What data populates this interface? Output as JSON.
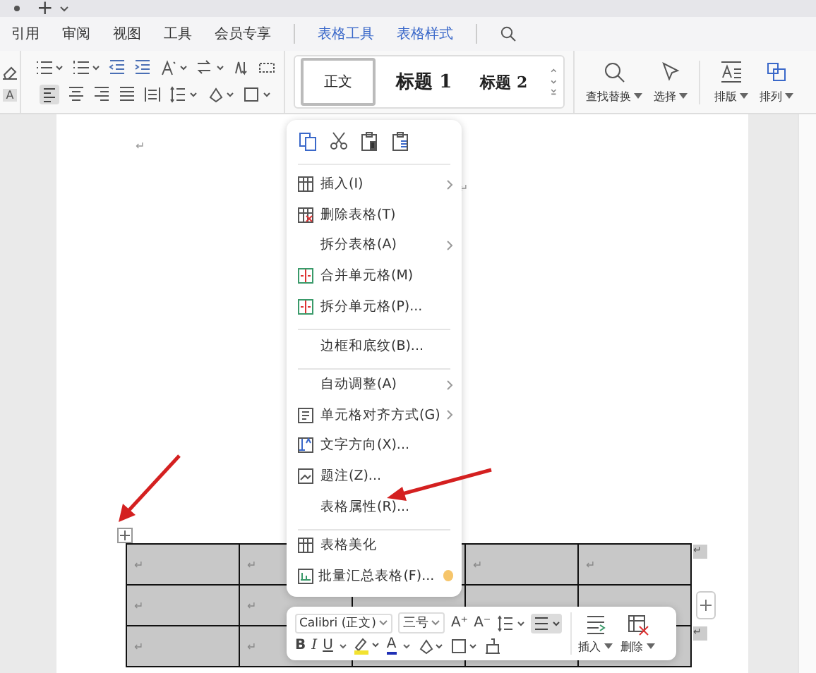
{
  "title_bar": {
    "new_tab": "+"
  },
  "menu_tabs": [
    {
      "label": "引用",
      "kind": "plain"
    },
    {
      "label": "审阅",
      "kind": "plain"
    },
    {
      "label": "视图",
      "kind": "plain"
    },
    {
      "label": "工具",
      "kind": "plain"
    },
    {
      "label": "会员专享",
      "kind": "plain"
    },
    {
      "label": "表格工具",
      "kind": "context"
    },
    {
      "label": "表格样式",
      "kind": "context"
    }
  ],
  "ribbon": {
    "char_style_letter": "A",
    "styles": [
      {
        "label": "正文",
        "selected": true
      },
      {
        "label": "标题 1",
        "selected": false
      },
      {
        "label": "标题 2",
        "selected": false
      }
    ],
    "tools": [
      {
        "label": "查找替换"
      },
      {
        "label": "选择"
      },
      {
        "label": "排版"
      },
      {
        "label": "排列"
      }
    ]
  },
  "page_marks": [
    "↵",
    "↵"
  ],
  "table": {
    "selected": true,
    "rows": [
      {
        "cells": [
          "↵",
          "↵",
          null,
          "↵",
          "↵"
        ],
        "end_mark": "↵"
      },
      {
        "cells": [
          "↵",
          "↵",
          null,
          null,
          null
        ],
        "end_mark": null
      },
      {
        "cells": [
          "↵",
          "↵",
          null,
          null,
          null
        ],
        "end_mark": "↵"
      }
    ]
  },
  "context_menu": {
    "items": [
      {
        "label": "插入(I)",
        "submenu": true,
        "divider_after": false,
        "premium": false
      },
      {
        "label": "删除表格(T)",
        "submenu": false,
        "divider_after": false,
        "premium": false
      },
      {
        "label": "拆分表格(A)",
        "submenu": true,
        "divider_after": false,
        "premium": false
      },
      {
        "label": "合并单元格(M)",
        "submenu": false,
        "divider_after": false,
        "premium": false
      },
      {
        "label": "拆分单元格(P)...",
        "submenu": false,
        "divider_after": true,
        "premium": false
      },
      {
        "label": "边框和底纹(B)...",
        "submenu": false,
        "divider_after": true,
        "premium": false
      },
      {
        "label": "自动调整(A)",
        "submenu": true,
        "divider_after": false,
        "premium": false
      },
      {
        "label": "单元格对齐方式(G)",
        "submenu": true,
        "divider_after": false,
        "premium": false
      },
      {
        "label": "文字方向(X)...",
        "submenu": false,
        "divider_after": false,
        "premium": false
      },
      {
        "label": "题注(Z)...",
        "submenu": false,
        "divider_after": false,
        "premium": false
      },
      {
        "label": "表格属性(R)...",
        "submenu": false,
        "divider_after": true,
        "premium": false
      },
      {
        "label": "表格美化",
        "submenu": false,
        "divider_after": false,
        "premium": false
      },
      {
        "label": "批量汇总表格(F)...",
        "submenu": false,
        "divider_after": false,
        "premium": true
      }
    ]
  },
  "mini_toolbar": {
    "font": "Calibri (正文)",
    "size": "三号",
    "grow": "A⁺",
    "shrink": "A⁻",
    "bold": "B",
    "italic": "I",
    "underline": "U",
    "font_color": "A",
    "align_selected": true,
    "insert": "插入",
    "delete": "删除"
  }
}
